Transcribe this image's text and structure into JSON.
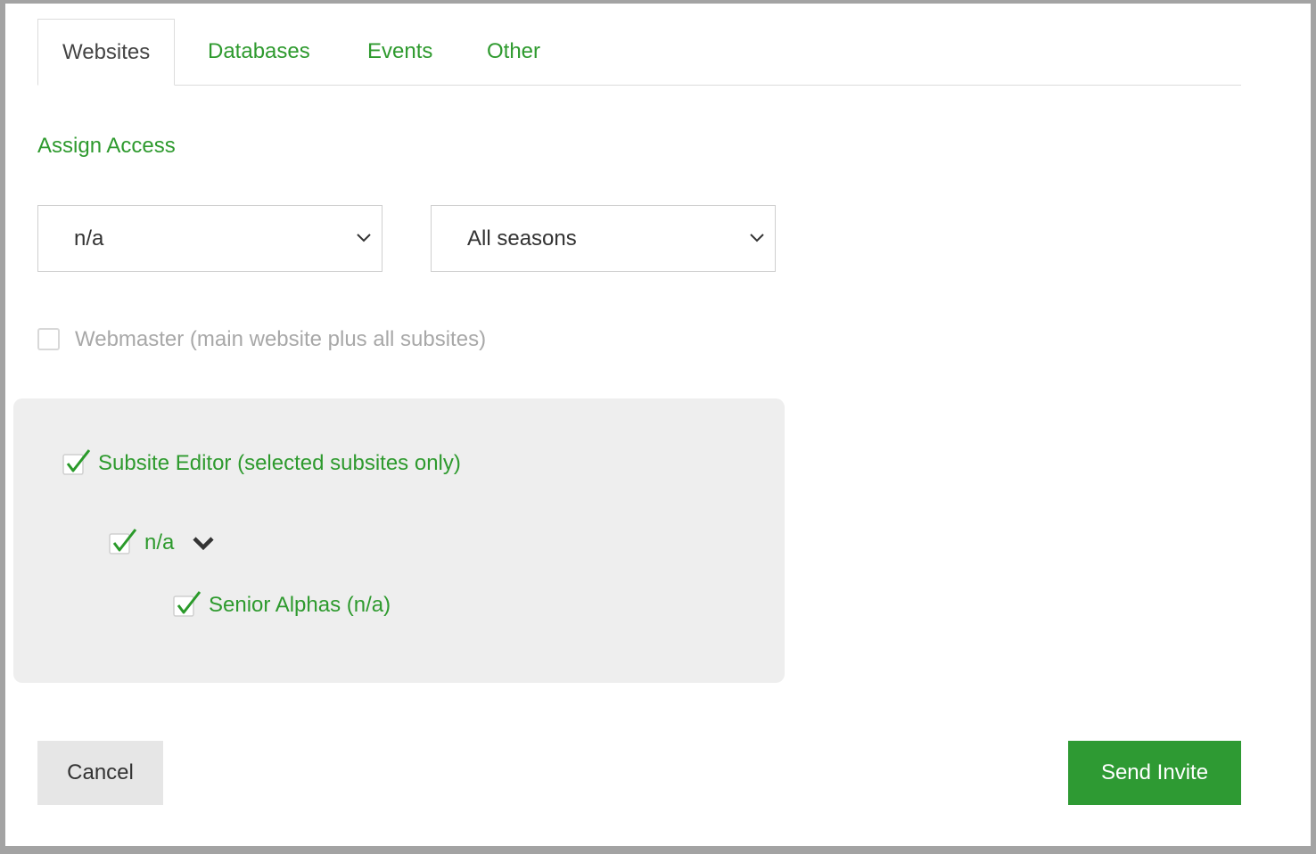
{
  "tabs": [
    {
      "label": "Websites",
      "active": true
    },
    {
      "label": "Databases",
      "active": false
    },
    {
      "label": "Events",
      "active": false
    },
    {
      "label": "Other",
      "active": false
    }
  ],
  "assign_access": {
    "title": "Assign Access",
    "organization_select": {
      "value": "n/a"
    },
    "season_select": {
      "value": "All seasons"
    }
  },
  "webmaster": {
    "label": "Webmaster (main website plus all subsites)",
    "checked": false,
    "disabled": true
  },
  "subsite_editor": {
    "label": "Subsite Editor (selected subsites only)",
    "checked": true,
    "group": {
      "label": "n/a",
      "checked": true,
      "expanded": true
    },
    "subsite": {
      "label": "Senior Alphas (n/a)",
      "checked": true
    }
  },
  "buttons": {
    "cancel": "Cancel",
    "send_invite": "Send Invite"
  },
  "colors": {
    "accent": "#2e9a2e",
    "button_primary": "#2e9a33",
    "panel_bg": "#eeeeee"
  },
  "icons": {
    "select_arrow": "chevron-down-icon",
    "expand_arrow": "chevron-down-icon",
    "check": "checkmark-icon"
  }
}
